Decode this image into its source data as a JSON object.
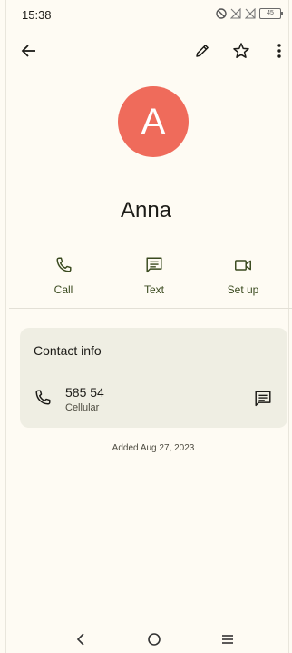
{
  "status_bar": {
    "time": "15:38",
    "battery": "45",
    "icons": [
      "do-not-disturb-icon",
      "no-signal-icon",
      "no-signal-icon",
      "battery-icon"
    ]
  },
  "app_bar": {
    "icons": [
      "back-arrow-icon",
      "edit-pencil-icon",
      "star-outline-icon",
      "more-vert-icon"
    ]
  },
  "contact": {
    "avatar_letter": "A",
    "avatar_color": "#ef6b5b",
    "name": "Anna"
  },
  "actions": [
    {
      "label": "Call",
      "icon": "phone-icon"
    },
    {
      "label": "Text",
      "icon": "message-icon"
    },
    {
      "label": "Set up",
      "icon": "video-camera-icon"
    }
  ],
  "contact_info": {
    "title": "Contact info",
    "phone": {
      "number": "585 54",
      "type": "Cellular"
    }
  },
  "added_text": "Added Aug 27, 2023",
  "colors": {
    "accent": "#3a4a1f",
    "background": "#fefbf3",
    "card": "#efeee3"
  },
  "nav_bar": {
    "icons": [
      "nav-back-icon",
      "nav-home-icon",
      "nav-recents-icon"
    ]
  }
}
